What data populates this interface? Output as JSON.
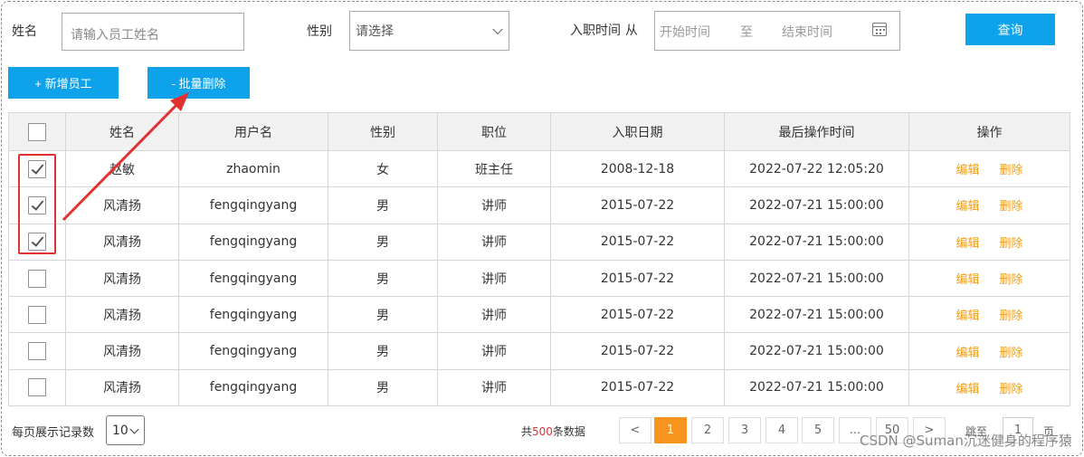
{
  "search": {
    "name_label": "姓名",
    "name_placeholder": "请输入员工姓名",
    "gender_label": "性别",
    "gender_select": "请选择",
    "date_label": "入职时间",
    "date_from": "从",
    "date_start_placeholder": "开始时间",
    "date_sep": "至",
    "date_end_placeholder": "结束时间",
    "query_button": "查询"
  },
  "actions": {
    "add_button": "+ 新增员工",
    "batch_delete_button": "- 批量删除"
  },
  "table": {
    "headers": [
      "姓名",
      "用户名",
      "性别",
      "职位",
      "入职日期",
      "最后操作时间",
      "操作"
    ],
    "edit_label": "编辑",
    "delete_label": "删除",
    "rows": [
      {
        "checked": true,
        "name": "赵敏",
        "username": "zhaomin",
        "gender": "女",
        "position": "班主任",
        "hire_date": "2008-12-18",
        "last_op": "2022-07-22 12:05:20"
      },
      {
        "checked": true,
        "name": "风清扬",
        "username": "fengqingyang",
        "gender": "男",
        "position": "讲师",
        "hire_date": "2015-07-22",
        "last_op": "2022-07-21 15:00:00"
      },
      {
        "checked": true,
        "name": "风清扬",
        "username": "fengqingyang",
        "gender": "男",
        "position": "讲师",
        "hire_date": "2015-07-22",
        "last_op": "2022-07-21 15:00:00"
      },
      {
        "checked": false,
        "name": "风清扬",
        "username": "fengqingyang",
        "gender": "男",
        "position": "讲师",
        "hire_date": "2015-07-22",
        "last_op": "2022-07-21 15:00:00"
      },
      {
        "checked": false,
        "name": "风清扬",
        "username": "fengqingyang",
        "gender": "男",
        "position": "讲师",
        "hire_date": "2015-07-22",
        "last_op": "2022-07-21 15:00:00"
      },
      {
        "checked": false,
        "name": "风清扬",
        "username": "fengqingyang",
        "gender": "男",
        "position": "讲师",
        "hire_date": "2015-07-22",
        "last_op": "2022-07-21 15:00:00"
      },
      {
        "checked": false,
        "name": "风清扬",
        "username": "fengqingyang",
        "gender": "男",
        "position": "讲师",
        "hire_date": "2015-07-22",
        "last_op": "2022-07-21 15:00:00"
      }
    ]
  },
  "pagination": {
    "page_size_label": "每页展示记录数",
    "page_size": "10",
    "total_prefix": "共",
    "total_count": "500",
    "total_suffix": "条数据",
    "prev": "<",
    "pages": [
      "1",
      "2",
      "3",
      "4",
      "5"
    ],
    "ellipsis": "...",
    "last_page": "50",
    "next": ">",
    "jump_prefix": "跳至",
    "jump_value": "1",
    "jump_suffix": "页"
  },
  "watermark": "CSDN @Suman沉迷健身的程序猿",
  "colors": {
    "primary": "#0da2ea",
    "active_page": "#f7941d",
    "operation": "#f39c12",
    "highlight": "#e23131"
  }
}
